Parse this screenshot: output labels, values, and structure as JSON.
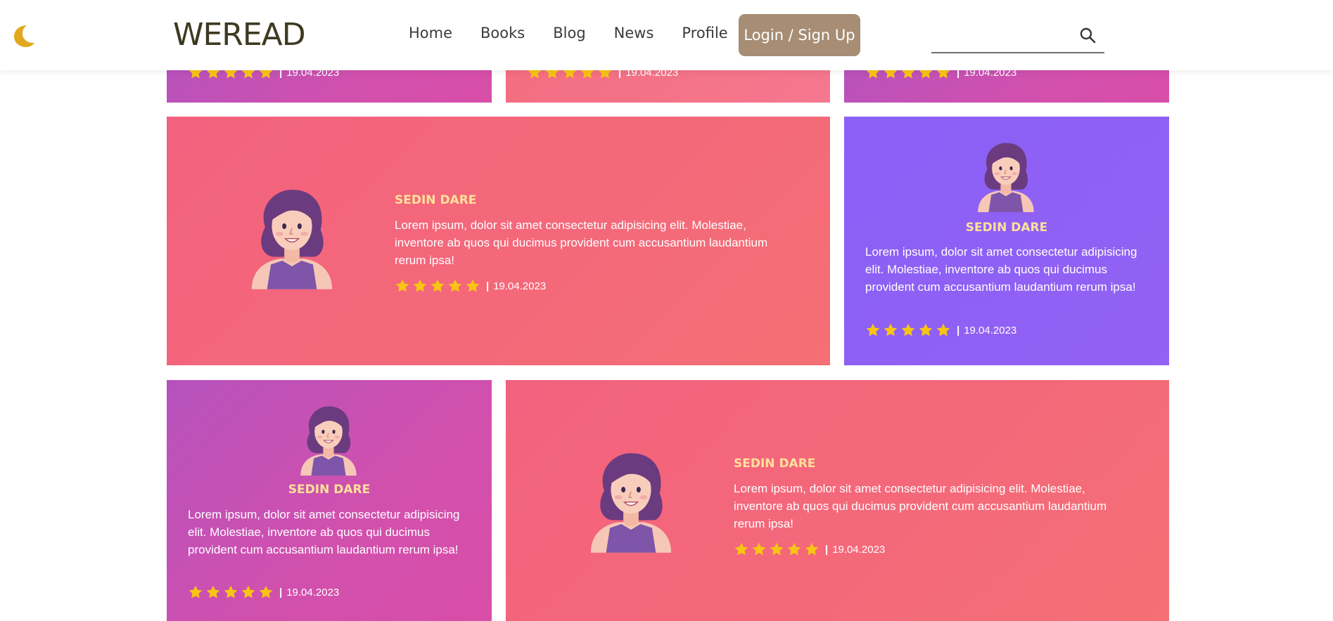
{
  "header": {
    "logo": "WEREAD",
    "nav": [
      "Home",
      "Books",
      "Blog",
      "News",
      "Profile"
    ],
    "login_label": "Login / Sign Up",
    "search_value": "",
    "search_placeholder": ""
  },
  "colors": {
    "accent": "#a68d74",
    "star": "#f9c513",
    "name": "#ffe19a",
    "moon": "#e0a81c"
  },
  "icons": [
    "moon-icon",
    "search-icon",
    "star-icon"
  ],
  "top_row": {
    "date": "19.04.2023"
  },
  "reviews": [
    {
      "name": "SEDIN DARE",
      "text": "Lorem ipsum, dolor sit amet consectetur adipisicing elit. Molestiae, inventore ab quos qui ducimus provident cum accusantium laudantium rerum ipsa!",
      "stars": 5,
      "date": "19.04.2023"
    },
    {
      "name": "SEDIN DARE",
      "text": "Lorem ipsum, dolor sit amet consectetur adipisicing elit. Molestiae, inventore ab quos qui ducimus provident cum accusantium laudantium rerum ipsa!",
      "stars": 5,
      "date": "19.04.2023"
    },
    {
      "name": "SEDIN DARE",
      "text": "Lorem ipsum, dolor sit amet consectetur adipisicing elit. Molestiae, inventore ab quos qui ducimus provident cum accusantium laudantium rerum ipsa!",
      "stars": 5,
      "date": "19.04.2023"
    },
    {
      "name": "SEDIN DARE",
      "text": "Lorem ipsum, dolor sit amet consectetur adipisicing elit. Molestiae, inventore ab quos qui ducimus provident cum accusantium laudantium rerum ipsa!",
      "stars": 5,
      "date": "19.04.2023"
    }
  ]
}
